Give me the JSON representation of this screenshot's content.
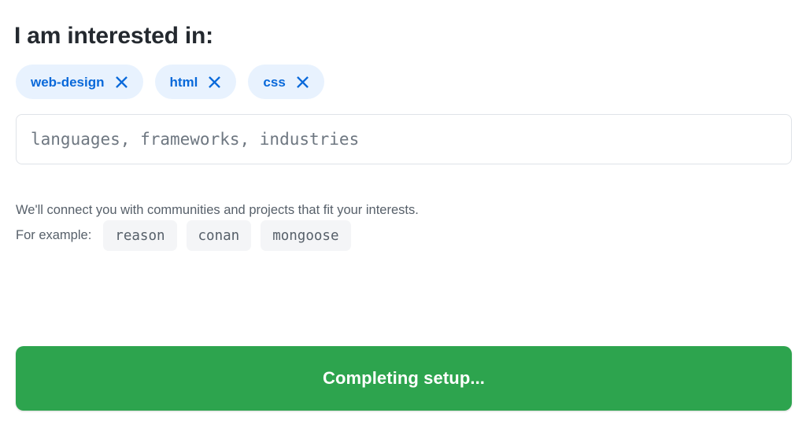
{
  "form": {
    "heading": "I am interested in:",
    "selected_tags": [
      {
        "label": "web-design",
        "remove_icon": "close-x-icon"
      },
      {
        "label": "html",
        "remove_icon": "close-x-icon"
      },
      {
        "label": "css",
        "remove_icon": "close-x-icon"
      }
    ],
    "input": {
      "value": "",
      "placeholder": "languages, frameworks, industries"
    },
    "helper_text": "We'll connect you with communities and projects that fit your interests.",
    "examples_label": "For example:",
    "examples": [
      "reason",
      "conan",
      "mongoose"
    ],
    "submit": {
      "label": "Completing setup...",
      "state": "busy"
    }
  },
  "colors": {
    "tag_background": "#e8f2fe",
    "tag_text": "#0969da",
    "submit_background": "#2da44e",
    "submit_text": "#ffffff",
    "helper_text": "#57606a",
    "heading_text": "#24292f",
    "chip_background": "#f4f5f7",
    "input_border": "#dfe3e8",
    "placeholder_text": "#6e7781"
  }
}
